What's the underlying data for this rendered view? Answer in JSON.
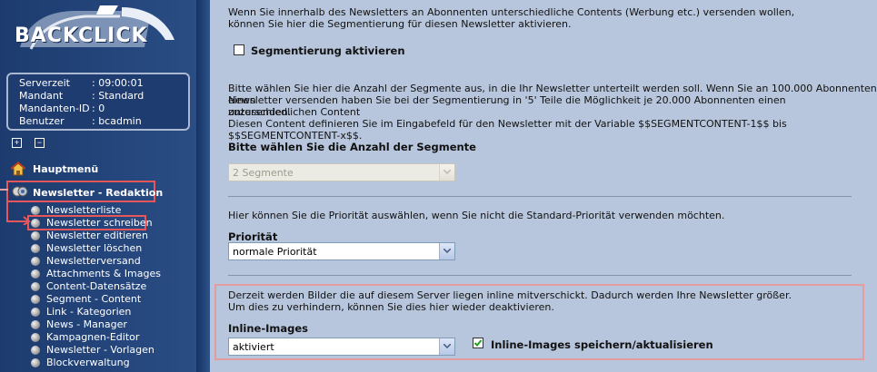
{
  "logo": {
    "text": "BACKCLICK"
  },
  "info": [
    {
      "key": "Serverzeit",
      "value": ": 09:00:01"
    },
    {
      "key": "Mandant",
      "value": ": Standard"
    },
    {
      "key": "Mandanten-ID",
      "value": ": 0"
    },
    {
      "key": "Benutzer",
      "value": ": bcadmin"
    }
  ],
  "tree_buttons": {
    "expand": "+",
    "collapse": "−"
  },
  "nav": {
    "main_menu": "Hauptmenü",
    "section": "Newsletter - Redaktion",
    "items": [
      "Newsletterliste",
      "Newsletter schreiben",
      "Newsletter editieren",
      "Newsletter löschen",
      "Newsletterversand",
      "Attachments & Images",
      "Content-Datensätze",
      "Segment - Content",
      "Link - Kategorien",
      "News - Manager",
      "Kampagnen-Editor",
      "Newsletter - Vorlagen",
      "Blockverwaltung"
    ],
    "active_index": 1
  },
  "content": {
    "intro_line1": "Wenn Sie innerhalb des Newsletters an Abonnenten unterschiedliche Contents (Werbung etc.) versenden wollen,",
    "intro_line2": "können Sie hier die Segmentierung für diesen Newsletter aktivieren.",
    "segment_checkbox_label": "Segmentierung aktivieren",
    "segment_checked": false,
    "desc_line1": "Bitte wählen Sie hier die Anzahl der Segmente aus, in die Ihr Newsletter unterteilt werden soll. Wenn Sie an 100.000 Abonnenten einen",
    "desc_line2": "Newsletter versenden haben Sie bei der Segmentierung in '5' Teile die Möglichkeit je 20.000 Abonnenten einen unterschiedlichen Content",
    "desc_line3": "zuzusenden.",
    "desc_line4": "Diesen Content definieren Sie im Eingabefeld für den Newsletter mit der Variable $$SEGMENTCONTENT-1$$ bis $$SEGMENTCONTENT-x$$.",
    "segments_heading": "Bitte wählen Sie die Anzahl der Segmente",
    "segments_value": "2 Segmente",
    "priority_desc": "Hier können Sie die Priorität auswählen, wenn Sie nicht die Standard-Priorität verwenden möchten.",
    "priority_label": "Priorität",
    "priority_value": "normale Priorität",
    "inline_desc1": "Derzeit werden Bilder die auf diesem Server liegen inline mitverschickt. Dadurch werden Ihre Newsletter größer.",
    "inline_desc2": "Um dies zu verhindern, können Sie dies hier wieder deaktivieren.",
    "inline_label": "Inline-Images",
    "inline_value": "aktiviert",
    "inline_save_label": "Inline-Images speichern/aktualisieren",
    "inline_save_checked": true
  }
}
